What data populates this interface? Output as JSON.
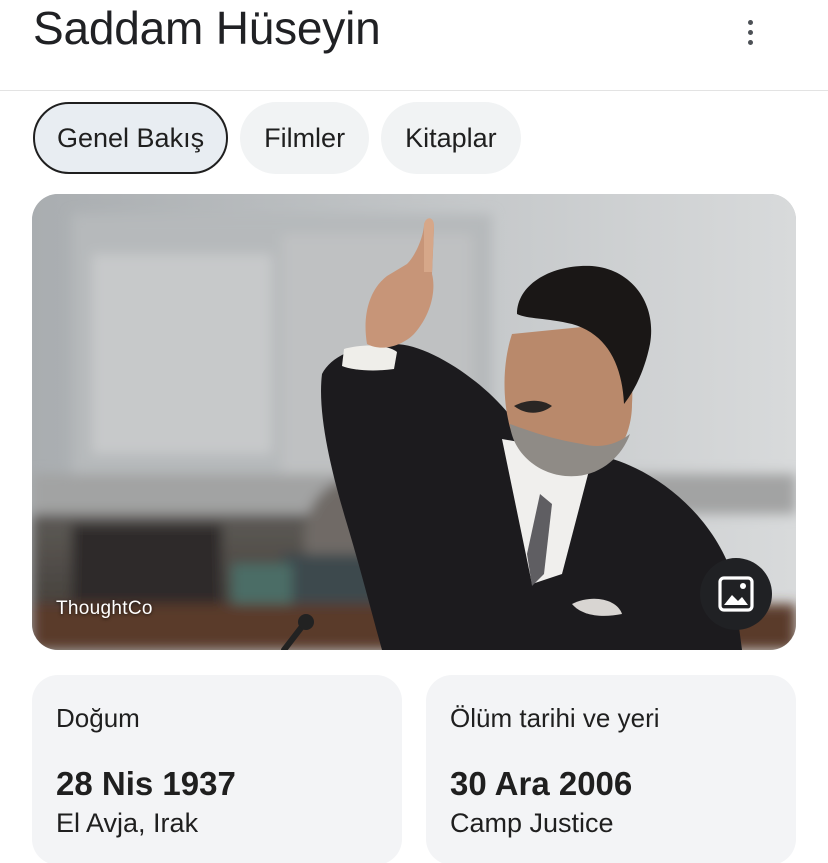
{
  "header": {
    "title": "Saddam Hüseyin",
    "more_icon": "more-vert-icon"
  },
  "chips": [
    {
      "label": "Genel Bakış",
      "active": true
    },
    {
      "label": "Filmler",
      "active": false
    },
    {
      "label": "Kitaplar",
      "active": false
    }
  ],
  "hero": {
    "source": "ThoughtCo",
    "image_icon": "image-icon"
  },
  "facts": [
    {
      "label": "Doğum",
      "date": "28 Nis 1937",
      "place": "El Avja, Irak"
    },
    {
      "label": "Ölüm tarihi ve yeri",
      "date": "30 Ara 2006",
      "place": "Camp Justice"
    }
  ],
  "colors": {
    "chip_bg": "#f1f3f4",
    "chip_active_bg": "#e8edf2",
    "card_bg": "#f3f4f6",
    "text": "#1f1f1f"
  }
}
